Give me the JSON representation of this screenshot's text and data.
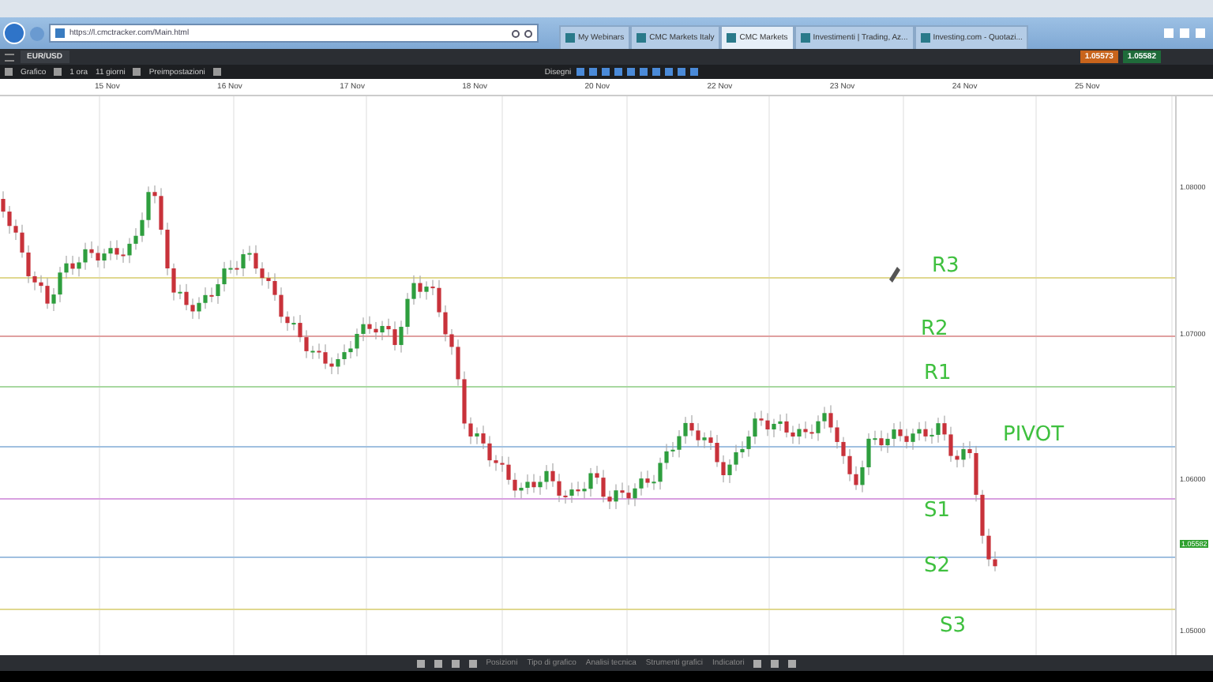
{
  "browser": {
    "url": "https://l.cmctracker.com/Main.html",
    "tabs": [
      {
        "title": "My Webinars",
        "selected": false
      },
      {
        "title": "CMC Markets Italy",
        "selected": false
      },
      {
        "title": "CMC Markets",
        "selected": true
      },
      {
        "title": "Investimenti | Trading, Az...",
        "selected": false
      },
      {
        "title": "Investing.com - Quotazi...",
        "selected": false
      }
    ]
  },
  "app": {
    "instrument": "EUR/USD",
    "prices": [
      {
        "value": "1.05573",
        "kind": "sell"
      },
      {
        "value": "1.05582",
        "kind": "buy"
      }
    ],
    "toolbar": {
      "chart_label": "Grafico",
      "interval": "1 ora",
      "range": "11 giorni",
      "presets": "Preimpostazioni",
      "drawings_label": "Disegni"
    }
  },
  "chart": {
    "dates": [
      "15 Nov",
      "16 Nov",
      "17 Nov",
      "18 Nov",
      "20 Nov",
      "22 Nov",
      "23 Nov",
      "24 Nov",
      "25 Nov"
    ],
    "price_ticks": [
      "1.08000",
      "1.07000",
      "1.06000",
      "1.05000"
    ],
    "current_price": "1.05582",
    "levels": [
      {
        "label": "R3",
        "color": "#e0d890"
      },
      {
        "label": "R2",
        "color": "#e0a0a0"
      },
      {
        "label": "R1",
        "color": "#a8d8a0"
      },
      {
        "label": "PIVOT",
        "color": "#a0c0e0"
      },
      {
        "label": "S1",
        "color": "#d8a0e0"
      },
      {
        "label": "S2",
        "color": "#a0c0e0"
      },
      {
        "label": "S3",
        "color": "#e0d890"
      }
    ]
  },
  "bottom_bar": {
    "tabs": [
      "Posizioni",
      "Tipo di grafico",
      "Analisi tecnica",
      "Strumenti grafici",
      "Indicatori"
    ]
  }
}
